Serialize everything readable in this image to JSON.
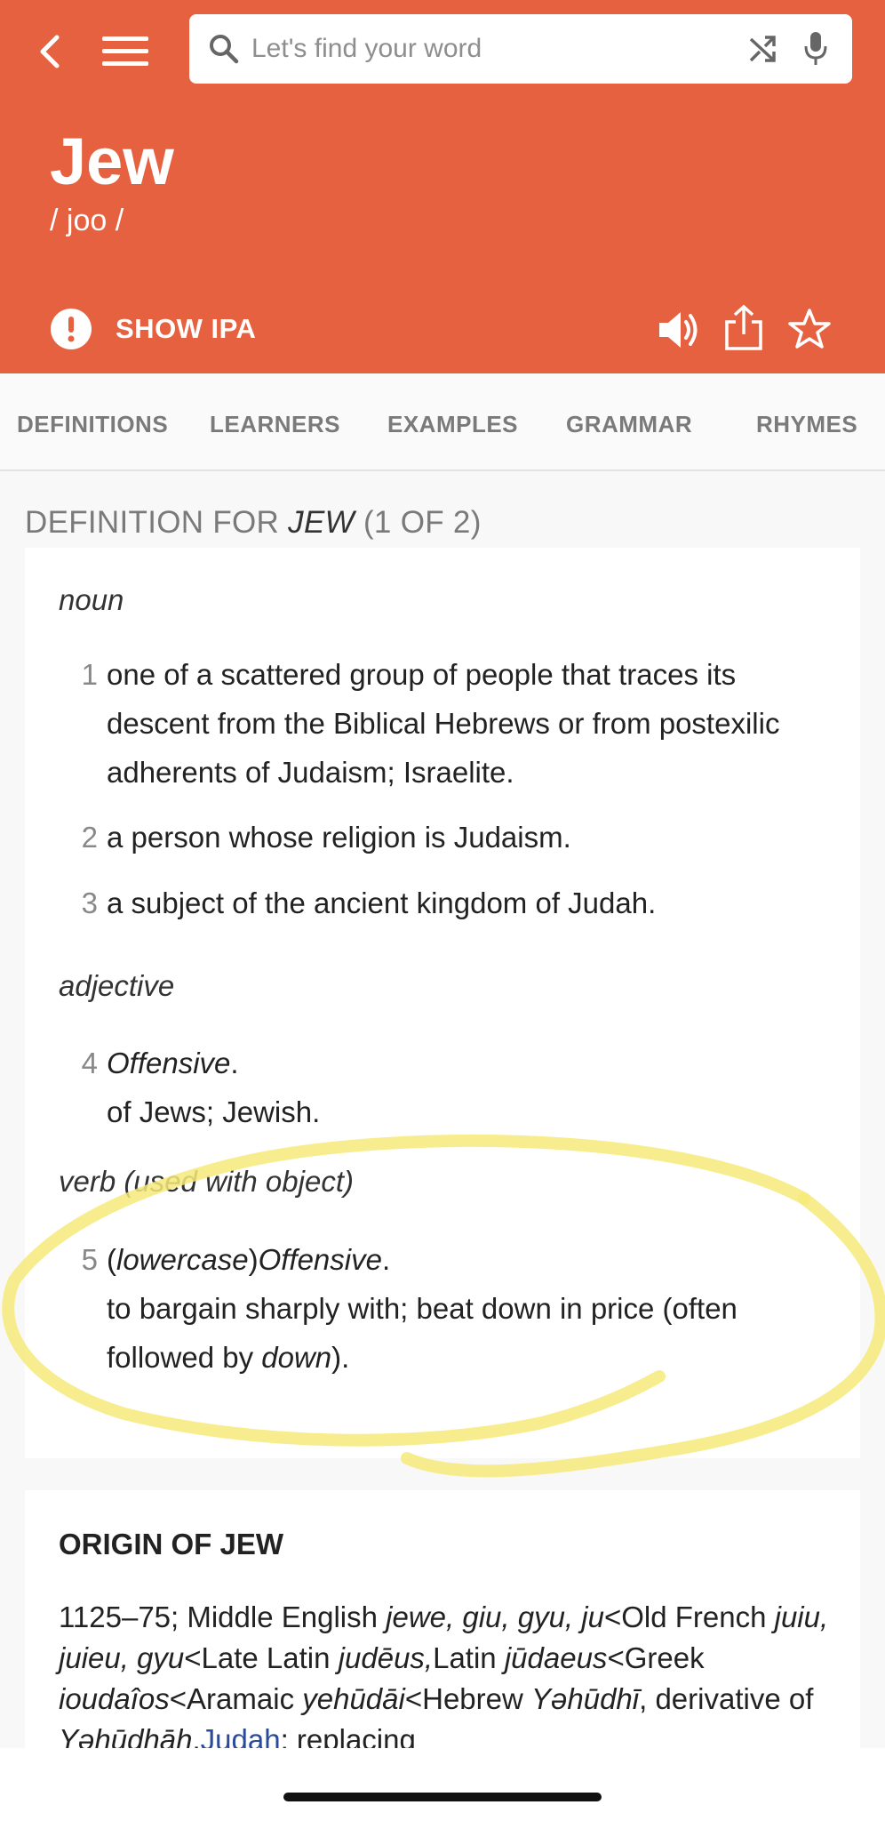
{
  "search": {
    "placeholder": "Let's find your word"
  },
  "entry": {
    "word": "Jew",
    "pronunciation": "/ joo  /"
  },
  "actions": {
    "show_ipa_label": "SHOW IPA"
  },
  "tabs": [
    "DEFINITIONS",
    "LEARNERS",
    "EXAMPLES",
    "GRAMMAR",
    "RHYMES"
  ],
  "definition_section": {
    "prefix": "DEFINITION FOR ",
    "word": "JEW",
    "suffix": " (1 OF 2)"
  },
  "definitions": {
    "noun_label": "noun",
    "adjective_label": "adjective",
    "verb_label": "verb (used with object)",
    "items": [
      {
        "num": "1",
        "text": "one of a scattered group of people that traces its descent from the Biblical Hebrews or from postexilic adherents of Judaism; Israelite."
      },
      {
        "num": "2",
        "text": "a person whose religion is Judaism."
      },
      {
        "num": "3",
        "text": "a subject of the ancient kingdom of Judah."
      },
      {
        "num": "4",
        "label": "Offensive",
        "period": ".",
        "text": "of Jews; Jewish."
      },
      {
        "num": "5",
        "paren_open": "(",
        "qualifier": "lowercase",
        "paren_close": ")",
        "label": "Offensive",
        "period": ".",
        "text_before": "to bargain sharply with; beat down in price (often followed by ",
        "text_italic": "down",
        "text_after": ")."
      }
    ]
  },
  "origin": {
    "title": "ORIGIN OF JEW",
    "segments": [
      {
        "t": "1125–75; Middle English ",
        "s": "n"
      },
      {
        "t": "jewe, giu, gyu, ju",
        "s": "i"
      },
      {
        "t": "<Old French ",
        "s": "n"
      },
      {
        "t": "juiu, juieu, gyu",
        "s": "i"
      },
      {
        "t": "<Late Latin ",
        "s": "n"
      },
      {
        "t": "judēus,",
        "s": "i"
      },
      {
        "t": "Latin ",
        "s": "n"
      },
      {
        "t": "jūdaeus",
        "s": "i"
      },
      {
        "t": "<Greek ",
        "s": "n"
      },
      {
        "t": "ioudaîos",
        "s": "i"
      },
      {
        "t": "<Aramaic ",
        "s": "n"
      },
      {
        "t": "yehūdāi",
        "s": "i"
      },
      {
        "t": "<Hebrew ",
        "s": "n"
      },
      {
        "t": "Yəhūdhī",
        "s": "i"
      },
      {
        "t": ", derivative of ",
        "s": "n"
      },
      {
        "t": "Yəhūdhāh",
        "s": "i"
      },
      {
        "t": ".",
        "s": "n"
      },
      {
        "t": "Judah",
        "s": "l"
      },
      {
        "t": "; replacing",
        "s": "n"
      }
    ]
  },
  "colors": {
    "header": "#e66140",
    "highlight": "#f7ea7a",
    "link": "#2a4a9a"
  },
  "icons": [
    "back-icon",
    "menu-icon",
    "search-icon",
    "shuffle-icon",
    "mic-icon",
    "info-icon",
    "speaker-icon",
    "share-icon",
    "star-icon"
  ]
}
